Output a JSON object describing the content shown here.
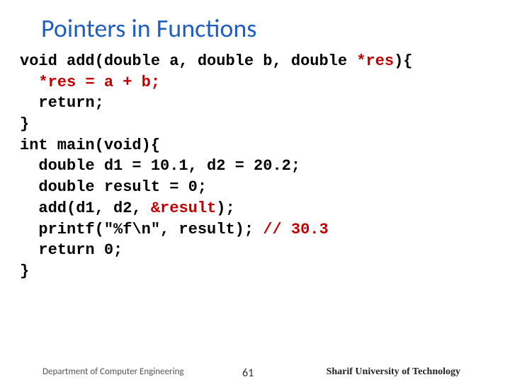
{
  "title": "Pointers in Functions",
  "code": {
    "l1a": "void add(double a, double b, double ",
    "l1b": "*res",
    "l1c": "){",
    "l2": "  *res = a + b;",
    "l3": "  return;",
    "l4": "}",
    "l5": "int main(void){",
    "l6": "  double d1 = 10.1, d2 = 20.2;",
    "l7": "  double result = 0;",
    "l8a": "  add(d1, d2, ",
    "l8b": "&result",
    "l8c": ");",
    "l9a": "  printf(\"%f\\n\", result); ",
    "l9b": "// 30.3",
    "l10": "  return 0;",
    "l11": "}"
  },
  "footer": {
    "dept": "Department of Computer Engineering",
    "page": "61",
    "uni": "Sharif University of Technology"
  }
}
